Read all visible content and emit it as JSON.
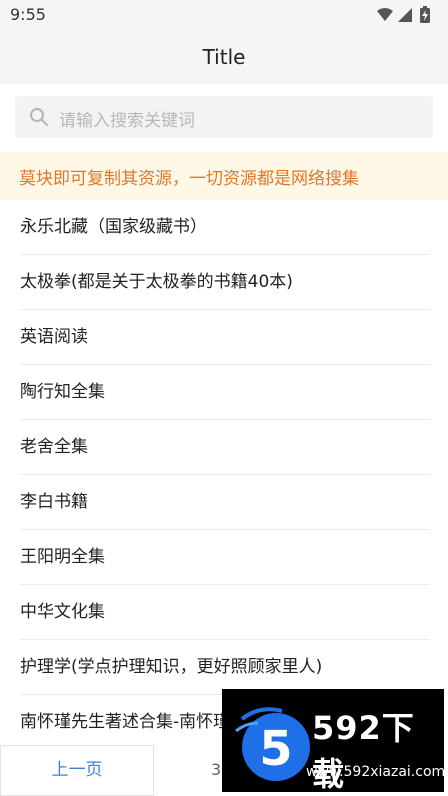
{
  "status_bar": {
    "time": "9:55",
    "icons": [
      "wifi-icon",
      "cell-signal-icon",
      "battery-charging-icon"
    ]
  },
  "header": {
    "title": "Title"
  },
  "search": {
    "placeholder": "请输入搜索关键词"
  },
  "notice": {
    "text": "莫块即可复制其资源，一切资源都是网络搜集",
    "color": "#e0782a",
    "background": "#fff8e7"
  },
  "books": [
    "永乐北藏（国家级藏书）",
    "太极拳(都是关于太极拳的书籍40本)",
    "英语阅读",
    "陶行知全集",
    "老舍全集",
    "李白书籍",
    "王阳明全集",
    "中华文化集",
    "护理学(学点护理知识，更好照顾家里人)",
    "南怀瑾先生著述合集-南怀瑾"
  ],
  "pager": {
    "prev_label": "上一页",
    "page_partial": "3"
  },
  "watermark": {
    "title": "592下载",
    "url": "www.592xiazai.com",
    "logo_digit": "5"
  },
  "colors": {
    "accent": "#3f7fe0",
    "header_bg": "#f5f5f5"
  }
}
